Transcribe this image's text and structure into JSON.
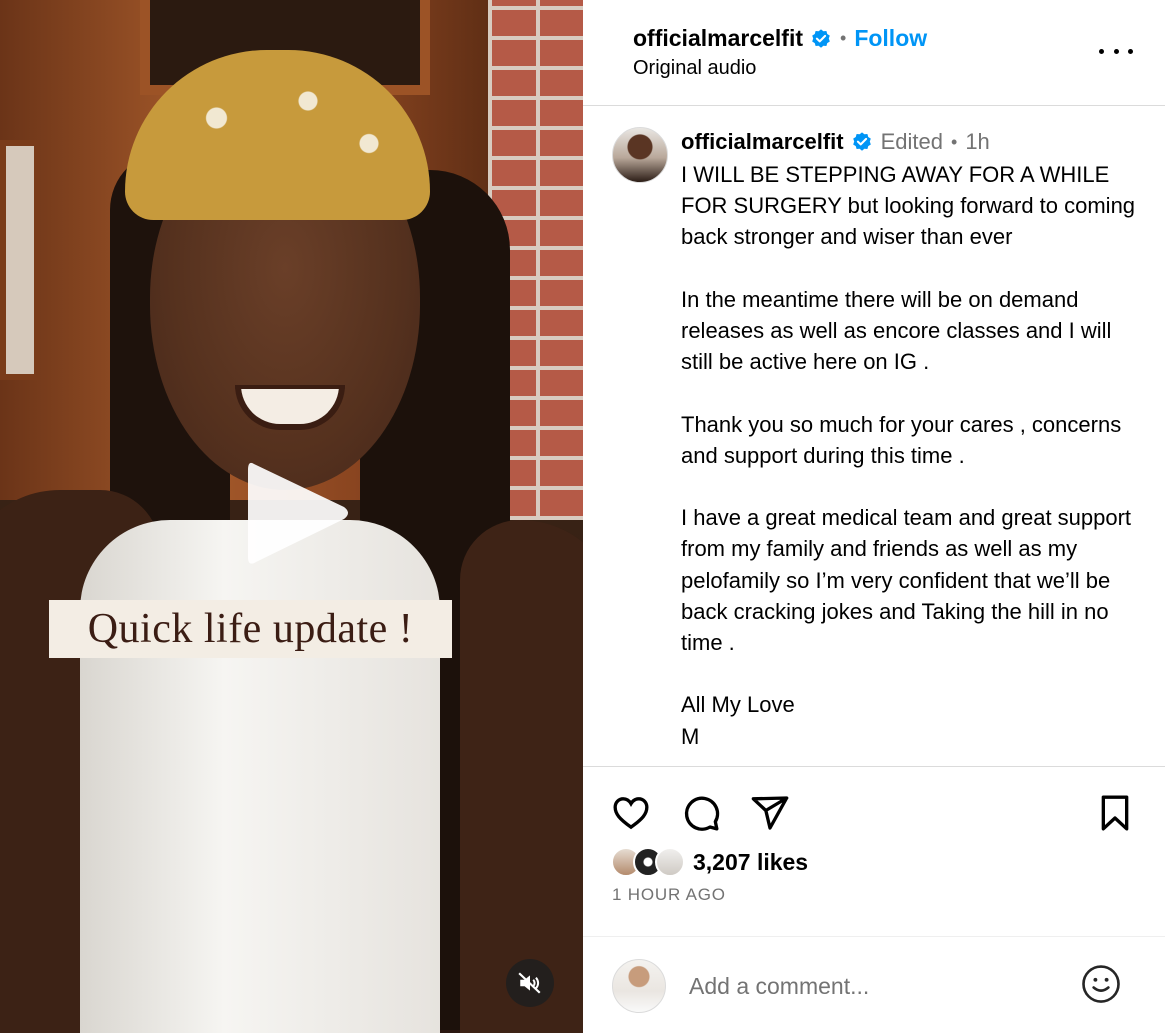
{
  "video": {
    "overlay_caption": "Quick life update !"
  },
  "header": {
    "username": "officialmarcelfit",
    "separator": "•",
    "follow_label": "Follow",
    "audio": "Original audio"
  },
  "caption": {
    "username": "officialmarcelfit",
    "edited": "Edited",
    "separator": "•",
    "time": "1h",
    "text": "I WILL BE STEPPING AWAY FOR A WHILE FOR SURGERY but looking forward to coming back stronger and wiser than ever\n\nIn the meantime there will be on demand releases as well as encore classes and I will still be active here on IG .\n\nThank you so much for your cares , concerns and support during this time .\n\nI have a great medical team and great support from my family and friends as well as my pelofamily so I’m very confident that we’ll be back cracking jokes and Taking the hill in no time .\n\nAll My Love\nM"
  },
  "engagement": {
    "likes": "3,207 likes",
    "posted": "1 HOUR AGO"
  },
  "comment": {
    "placeholder": "Add a comment..."
  },
  "icons": {
    "verified": "verified-badge-icon",
    "more": "more-options-icon",
    "like": "heart-icon",
    "comment": "comment-bubble-icon",
    "share": "paper-plane-icon",
    "save": "bookmark-icon",
    "emoji": "smiley-icon",
    "play": "play-icon",
    "mute": "muted-speaker-icon"
  },
  "colors": {
    "accent": "#0095f6",
    "secondary_text": "#737373",
    "divider": "#dbdbdb"
  }
}
